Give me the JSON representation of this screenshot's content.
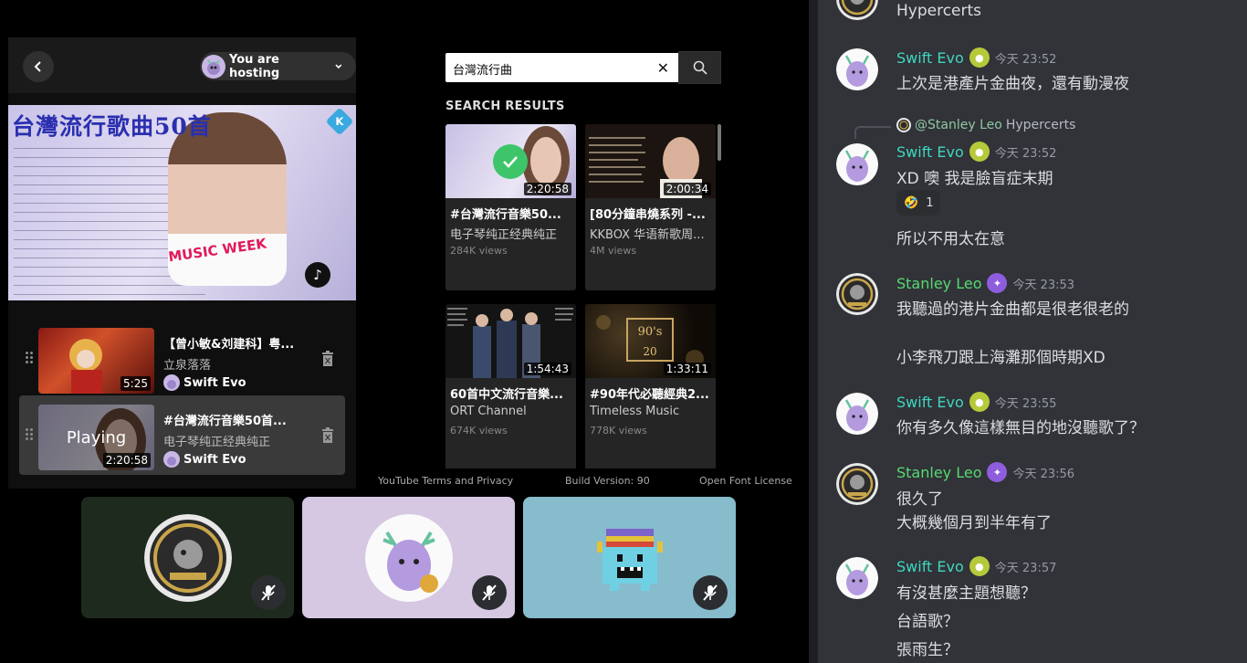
{
  "activity": {
    "host_label": "You are hosting",
    "player": {
      "title": "台灣流行歌曲50首",
      "badge": "K",
      "tag": "MUSIC WEEK"
    },
    "queue": [
      {
        "title": "【曾小敏&刘建科】粤...",
        "channel": "立泉落落",
        "user": "Swift Evo",
        "duration": "5:25",
        "playing": ""
      },
      {
        "title": "#台灣流行音樂50首...",
        "channel": "电子琴纯正经典纯正",
        "user": "Swift Evo",
        "duration": "2:20:58",
        "playing": "Playing"
      }
    ],
    "search": {
      "value": "台灣流行曲",
      "clear": "✕"
    },
    "results_title": "SEARCH RESULTS",
    "results": [
      {
        "title": "#台灣流行音樂50...",
        "channel": "电子琴纯正经典纯正",
        "views": "284K views",
        "duration": "2:20:58"
      },
      {
        "title": "[80分鐘串燒系列 -...",
        "channel": "KKBOX 华语新歌周...",
        "views": "4M views",
        "duration": "2:00:34"
      },
      {
        "title": "60首中文流行音樂...",
        "channel": "ORT Channel",
        "views": "674K views",
        "duration": "1:54:43"
      },
      {
        "title": "#90年代必聽經典2...",
        "channel": "Timeless Music",
        "views": "778K views",
        "duration": "1:33:11"
      }
    ],
    "footer": {
      "terms": "YouTube Terms and Privacy",
      "build": "Build Version: 90",
      "license": "Open Font License"
    }
  },
  "chat": {
    "top_line": "Hypercerts",
    "messages": [
      {
        "user": "Swift Evo",
        "time": "今天 23:52",
        "lines": [
          "上次是港產片金曲夜，還有動漫夜"
        ]
      },
      {
        "reply_to": "@Stanley Leo",
        "reply_text": "Hypercerts",
        "user": "Swift Evo",
        "time": "今天 23:52",
        "lines": [
          "XD 噢  我是臉盲症末期",
          "所以不用太在意"
        ],
        "reaction": {
          "emoji": "🤣",
          "count": "1"
        }
      },
      {
        "user": "Stanley Leo",
        "time": "今天 23:53",
        "lines": [
          "我聽過的港片金曲都是很老很老的",
          "小李飛刀跟上海灘那個時期XD"
        ]
      },
      {
        "user": "Swift Evo",
        "time": "今天 23:55",
        "lines": [
          "你有多久像這樣無目的地沒聽歌了？"
        ]
      },
      {
        "user": "Stanley Leo",
        "time": "今天 23:56",
        "lines": [
          "很久了",
          "大概幾個月到半年有了"
        ]
      },
      {
        "user": "Swift Evo",
        "time": "今天 23:57",
        "lines": [
          "有沒甚麼主題想聽？",
          "台語歌？",
          "張雨生？"
        ]
      }
    ]
  }
}
